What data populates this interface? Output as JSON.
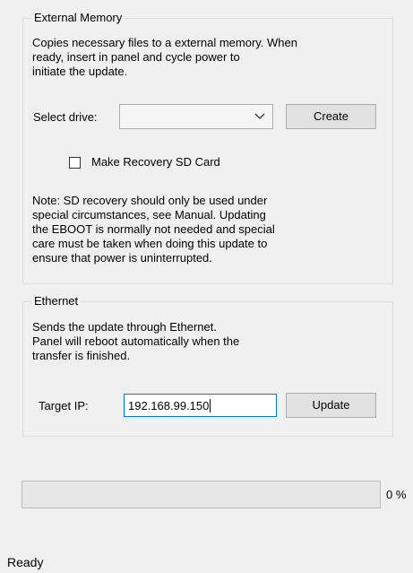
{
  "external_memory": {
    "title": "External Memory",
    "description": [
      "Copies necessary files to a external memory. When",
      "ready, insert in panel and cycle power to",
      "initiate the update."
    ],
    "select_drive_label": "Select drive:",
    "drive_value": "",
    "create_button": "Create",
    "recovery_checkbox_label": "Make Recovery SD Card",
    "recovery_checked": false,
    "note": [
      "Note: SD recovery should only be used under",
      "special circumstances, see Manual. Updating",
      "the EBOOT is normally not needed and special",
      "care must be taken when doing this update to",
      "ensure that power is uninterrupted."
    ]
  },
  "ethernet": {
    "title": "Ethernet",
    "description": [
      "Sends the update through Ethernet.",
      "Panel will reboot automatically when the",
      "transfer is finished."
    ],
    "target_ip_label": "Target IP:",
    "target_ip_value": "192.168.99.150",
    "update_button": "Update"
  },
  "progress": {
    "value_percent": 0,
    "label": "0 %"
  },
  "status": {
    "text": "Ready"
  },
  "colors": {
    "window_bg": "#f0f0f0",
    "focus_border": "#0078d7",
    "progress_fill": "#06b025"
  },
  "icons": {
    "combo_dropdown": "chevron-down-icon"
  }
}
